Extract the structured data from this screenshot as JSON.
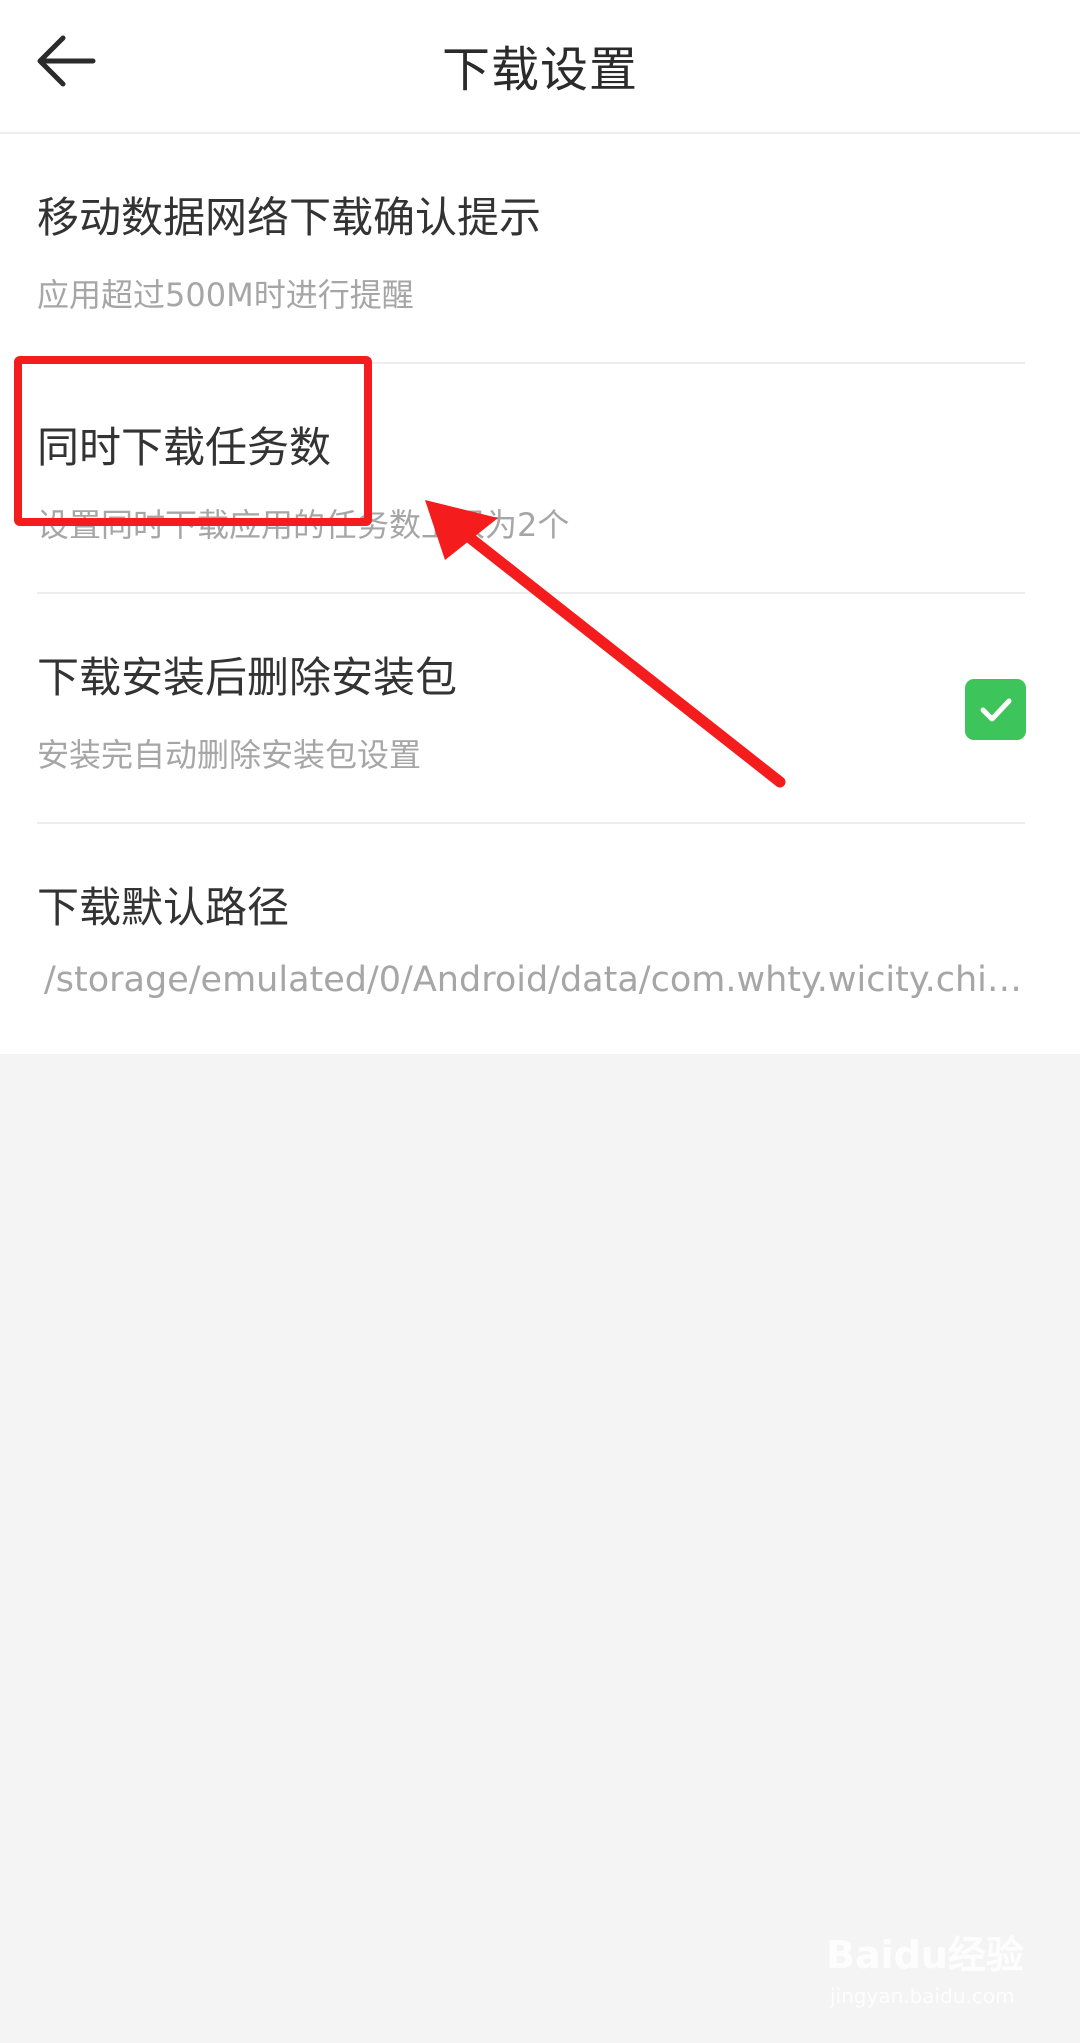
{
  "header": {
    "title": "下载设置",
    "back_icon": "arrow-left-icon"
  },
  "settings": [
    {
      "title": "移动数据网络下载确认提示",
      "subtitle": "应用超过500M时进行提醒"
    },
    {
      "title": "同时下载任务数",
      "subtitle": "设置同时下载应用的任务数上限为2个"
    },
    {
      "title": "下载安装后删除安装包",
      "subtitle": "安装完自动删除安装包设置",
      "checked": true
    },
    {
      "title": "下载默认路径",
      "subtitle": "/storage/emulated/0/Android/data/com.whty.wicity.china/..."
    }
  ],
  "colors": {
    "accent_green": "#3dc45b",
    "annotation_red": "#f41c1c",
    "background": "#f4f4f4"
  },
  "annotation": {
    "type": "red-box-and-arrow",
    "target": "同时下载任务数"
  },
  "watermark": {
    "brand": "Baidu经验",
    "url": "jingyan.baidu.com"
  }
}
